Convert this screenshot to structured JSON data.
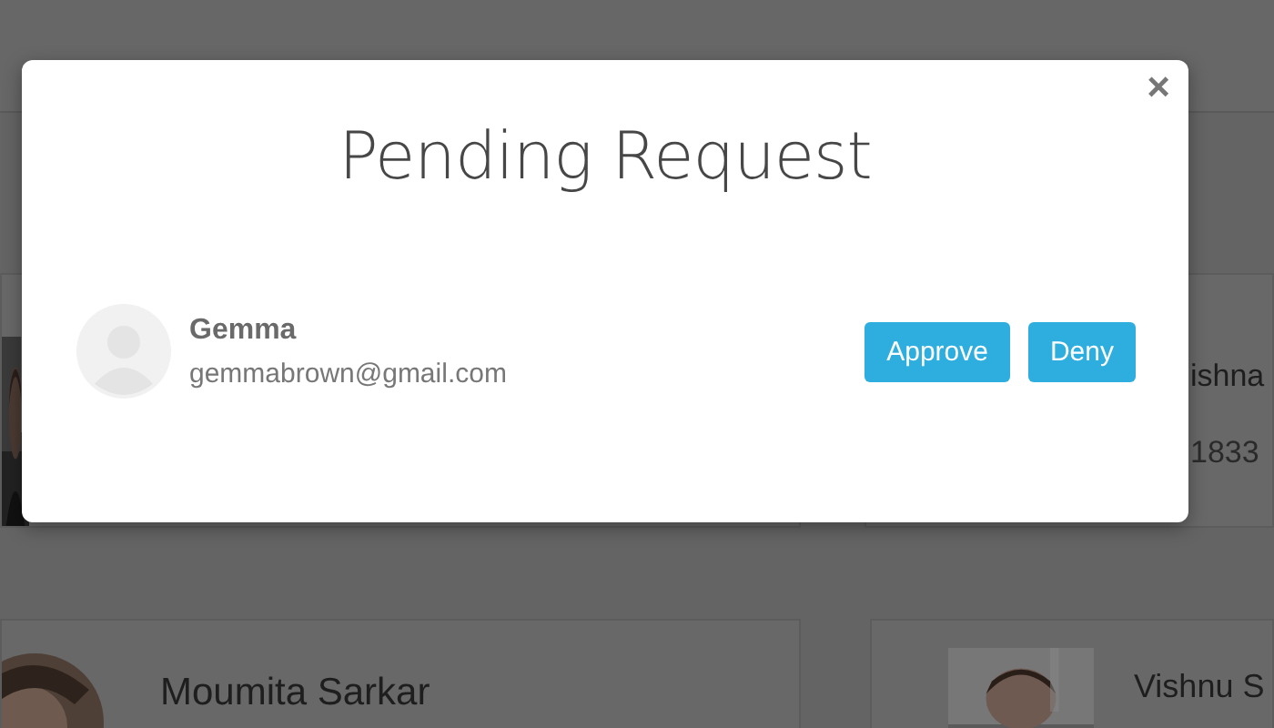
{
  "background_cards": [
    {
      "name": "ishna",
      "detail": "1833"
    },
    {
      "name": "Moumita Sarkar"
    },
    {
      "name": "Vishnu S"
    }
  ],
  "modal": {
    "title": "Pending Request",
    "close": "×",
    "requests": [
      {
        "name": "Gemma",
        "email": "gemmabrown@gmail.com",
        "actions": [
          {
            "label": "Approve",
            "kind": "primary"
          },
          {
            "label": "Deny",
            "kind": "primary"
          }
        ]
      }
    ]
  }
}
